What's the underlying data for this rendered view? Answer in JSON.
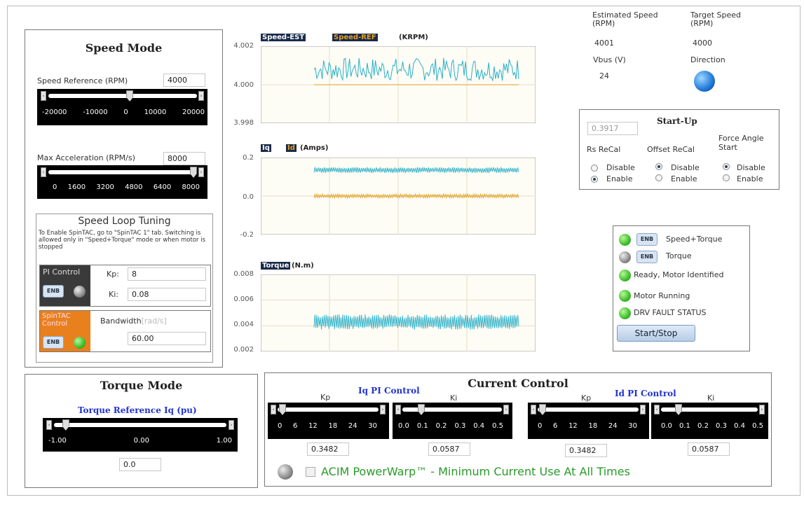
{
  "speed_mode": {
    "title": "Speed Mode",
    "speed_ref_label": "Speed Reference (RPM)",
    "speed_ref_value": "4000",
    "speed_ticks": [
      "-20000",
      "-10000",
      "0",
      "10000",
      "20000"
    ],
    "speed_slider_level": 0.55,
    "max_accel_label": "Max Acceleration (RPM/s)",
    "max_accel_value": "8000",
    "accel_ticks": [
      "0",
      "1600",
      "3200",
      "4800",
      "6400",
      "8000"
    ],
    "accel_slider_level": 1.0
  },
  "speed_loop": {
    "title": "Speed Loop Tuning",
    "note": "To Enable SpinTAC, go to \"SpinTAC 1\" tab. Switching is allowed only in \"Speed+Torque\" mode or when motor is stopped",
    "pi_label": "PI Control",
    "kp_label": "Kp:",
    "kp_value": "8",
    "ki_label": "Ki:",
    "ki_value": "0.08",
    "enb": "ENB",
    "spintac_label": "SpinTAC Control",
    "bandwidth_label": "Bandwidth",
    "bandwidth_unit": "[rad/s]",
    "bandwidth_value": "60.00"
  },
  "torque_mode": {
    "title": "Torque Mode",
    "ref_label": "Torque Reference Iq (pu)",
    "ticks": [
      "-1.00",
      "0.00",
      "1.00"
    ],
    "slider_level": 0.05,
    "value": "0.0"
  },
  "charts": {
    "speed": {
      "legend_a": "Speed-EST",
      "legend_b": "Speed-REF",
      "unit": "(KRPM)",
      "yticks": [
        "4.002",
        "4.000",
        "3.998"
      ]
    },
    "current": {
      "legend_a": "Iq",
      "legend_b": "Id",
      "unit": "(Amps)",
      "yticks": [
        "0.2",
        "0.0",
        "-0.2"
      ]
    },
    "torque": {
      "legend_a": "Torque",
      "unit": "(N.m)",
      "yticks": [
        "0.008",
        "0.006",
        "0.004",
        "0.002"
      ]
    }
  },
  "chart_data": [
    {
      "type": "line",
      "title": "",
      "ylabel": "(KRPM)",
      "ylim": [
        3.998,
        4.002
      ],
      "series": [
        {
          "name": "Speed-EST",
          "approx_mean": 4.0008,
          "approx_amplitude": 0.0006
        },
        {
          "name": "Speed-REF",
          "approx_value": 4.0
        }
      ]
    },
    {
      "type": "line",
      "title": "",
      "ylabel": "(Amps)",
      "ylim": [
        -0.2,
        0.2
      ],
      "series": [
        {
          "name": "Iq",
          "approx_mean": 0.135,
          "approx_amplitude": 0.015
        },
        {
          "name": "Id",
          "approx_mean": 0.0,
          "approx_amplitude": 0.01
        }
      ]
    },
    {
      "type": "line",
      "title": "",
      "ylabel": "(N.m)",
      "ylim": [
        0.002,
        0.008
      ],
      "series": [
        {
          "name": "Torque",
          "approx_mean": 0.0043,
          "approx_amplitude": 0.0006
        }
      ]
    }
  ],
  "status": {
    "est_speed_label": "Estimated Speed (RPM)",
    "est_speed_value": "4001",
    "target_speed_label": "Target Speed (RPM)",
    "target_speed_value": "4000",
    "vbus_label": "Vbus (V)",
    "vbus_value": "24",
    "direction_label": "Direction"
  },
  "startup": {
    "title": "Start-Up",
    "value": "0.3917",
    "rs_label": "Rs ReCal",
    "offset_label": "Offset ReCal",
    "force_label": "Force Angle Start",
    "disable": "Disable",
    "enable": "Enable"
  },
  "modes": {
    "enb": "ENB",
    "speed_torque": "Speed+Torque",
    "torque": "Torque",
    "ready": "Ready, Motor Identified",
    "running": "Motor Running",
    "fault": "DRV FAULT STATUS",
    "start_stop": "Start/Stop"
  },
  "current_control": {
    "title": "Current Control",
    "iq_title": "Iq PI Control",
    "id_title": "Id PI Control",
    "kp_label": "Kp",
    "ki_label": "Ki",
    "kp_ticks": [
      "0",
      "6",
      "12",
      "18",
      "24",
      "30"
    ],
    "ki_ticks": [
      "0.0",
      "0.1",
      "0.2",
      "0.3",
      "0.4",
      "0.5"
    ],
    "iq_kp_value": "0.3482",
    "iq_ki_value": "0.0587",
    "id_kp_value": "0.3482",
    "id_ki_value": "0.0587",
    "powerwarp": "ACIM PowerWarp™ - Minimum Current Use At All Times"
  },
  "colors": {
    "est": "#2ab0c8",
    "ref": "#e0a020",
    "spintac": "#e8801e",
    "blue_title": "#2233cc",
    "powerwarp": "#2a9a2a"
  }
}
